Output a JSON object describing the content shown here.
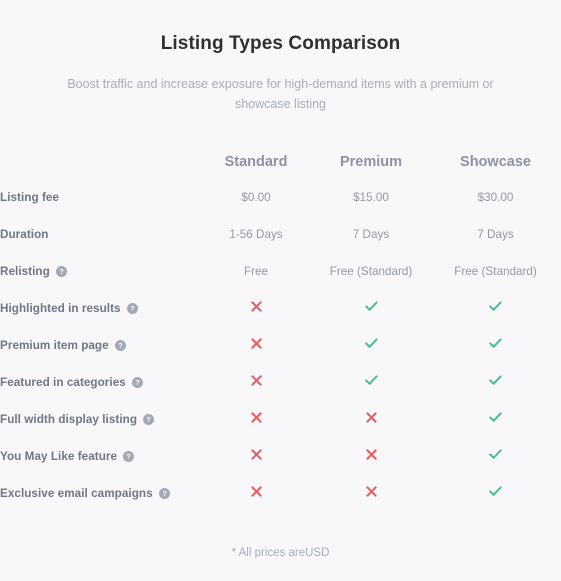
{
  "header": {
    "title": "Listing Types Comparison",
    "subtitle": "Boost traffic and increase exposure for high-demand items with a premium or showcase listing"
  },
  "table": {
    "label_column_header": "",
    "columns": [
      {
        "key": "standard",
        "label": "Standard"
      },
      {
        "key": "premium",
        "label": "Premium"
      },
      {
        "key": "showcase",
        "label": "Showcase"
      }
    ],
    "rows": [
      {
        "label": "Listing fee",
        "has_help": false,
        "help_icon": "",
        "values": [
          "$0.00",
          "$15.00",
          "$30.00"
        ],
        "types": [
          "text",
          "text",
          "text"
        ]
      },
      {
        "label": "Duration",
        "has_help": false,
        "help_icon": "",
        "values": [
          "1-56 Days",
          "7 Days",
          "7 Days"
        ],
        "types": [
          "text",
          "text",
          "text"
        ]
      },
      {
        "label": "Relisting",
        "has_help": true,
        "help_icon": "help-circle-icon",
        "values": [
          "Free",
          "Free (Standard)",
          "Free (Standard)"
        ],
        "types": [
          "text",
          "text",
          "text"
        ]
      },
      {
        "label": "Highlighted in results",
        "has_help": true,
        "help_icon": "help-circle-icon",
        "values": [
          "cross",
          "check",
          "check"
        ],
        "types": [
          "mark",
          "mark",
          "mark"
        ]
      },
      {
        "label": "Premium item page",
        "has_help": true,
        "help_icon": "help-circle-icon",
        "values": [
          "cross",
          "check",
          "check"
        ],
        "types": [
          "mark",
          "mark",
          "mark"
        ]
      },
      {
        "label": "Featured in categories",
        "has_help": true,
        "help_icon": "help-circle-icon",
        "values": [
          "cross",
          "check",
          "check"
        ],
        "types": [
          "mark",
          "mark",
          "mark"
        ]
      },
      {
        "label": "Full width display listing",
        "has_help": true,
        "help_icon": "help-circle-icon",
        "values": [
          "cross",
          "cross",
          "check"
        ],
        "types": [
          "mark",
          "mark",
          "mark"
        ]
      },
      {
        "label": "You May Like feature",
        "has_help": true,
        "help_icon": "help-circle-icon",
        "values": [
          "cross",
          "cross",
          "check"
        ],
        "types": [
          "mark",
          "mark",
          "mark"
        ]
      },
      {
        "label": "Exclusive email campaigns",
        "has_help": true,
        "help_icon": "help-circle-icon",
        "values": [
          "cross",
          "cross",
          "check"
        ],
        "types": [
          "mark",
          "mark",
          "mark"
        ]
      }
    ]
  },
  "footnote": "* All prices areUSD",
  "colors": {
    "background": "#f8f8fa",
    "title": "#2f2f33",
    "muted_text": "#a7adb8",
    "row_label": "#6f7684",
    "column_header": "#8c93a0",
    "value_text": "#9299a5",
    "check_green": "#4bbd8a",
    "cross_red": "#e8605f",
    "help_icon_gray": "#a2a9b5"
  }
}
